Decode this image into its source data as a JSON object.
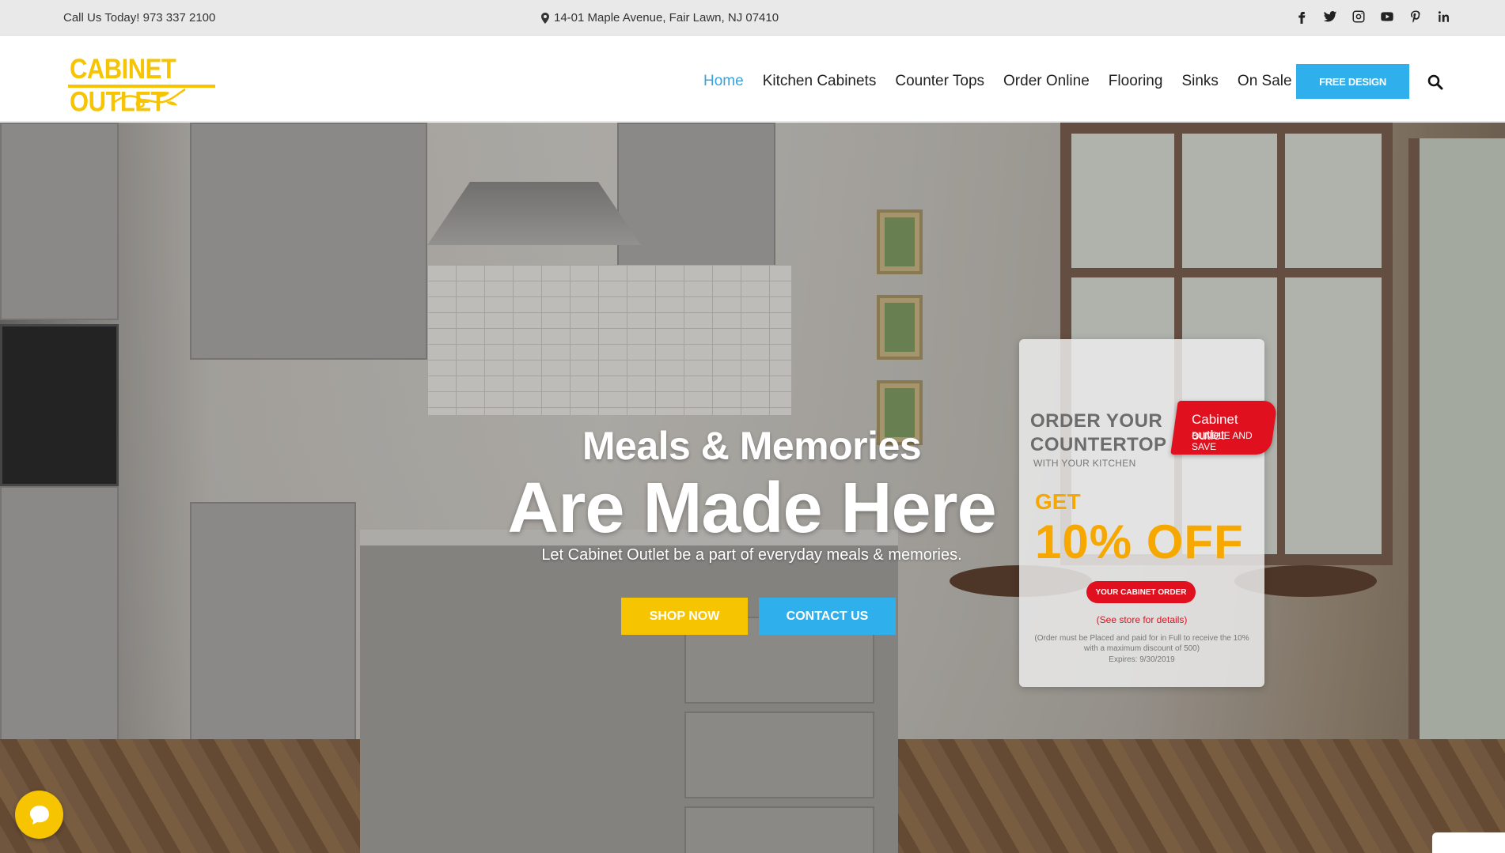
{
  "topbar": {
    "phone": "Call Us Today! 973 337 2100",
    "address": "14-01 Maple Avenue, Fair Lawn, NJ 07410",
    "social_icons": [
      "facebook-icon",
      "twitter-icon",
      "instagram-icon",
      "youtube-icon",
      "pinterest-icon",
      "linkedin-icon"
    ]
  },
  "header": {
    "logo_text": "CABINET OUTLET",
    "nav": [
      {
        "label": "Home",
        "active": true
      },
      {
        "label": "Kitchen Cabinets"
      },
      {
        "label": "Counter Tops"
      },
      {
        "label": "Order Online"
      },
      {
        "label": "Flooring"
      },
      {
        "label": "Sinks"
      },
      {
        "label": "On Sale"
      }
    ],
    "cta_label": "FREE DESIGN"
  },
  "hero": {
    "subtitle": "Meals & Memories",
    "title": "Are Made Here",
    "description": "Let Cabinet Outlet be a part of everyday meals & memories.",
    "shop_label": "SHOP NOW",
    "contact_label": "CONTACT US"
  },
  "promo": {
    "line1": "ORDER YOUR",
    "line2": "COUNTERTOP",
    "line3": "WITH YOUR KITCHEN",
    "ribbon1": "Cabinet outlet",
    "ribbon2": "BUNDLE AND SAVE",
    "get": "GET",
    "off": "10% OFF",
    "pill": "YOUR CABINET ORDER",
    "see_store": "(See store for details)",
    "fine_print": "(Order must be Placed and paid for in Full to receive the 10% with a maximum discount of 500)",
    "expires": "Expires: 9/30/2019"
  },
  "colors": {
    "brand_yellow": "#f6c400",
    "accent_blue": "#2fb0ec",
    "promo_red": "#e0101e",
    "promo_orange": "#f6a800"
  }
}
